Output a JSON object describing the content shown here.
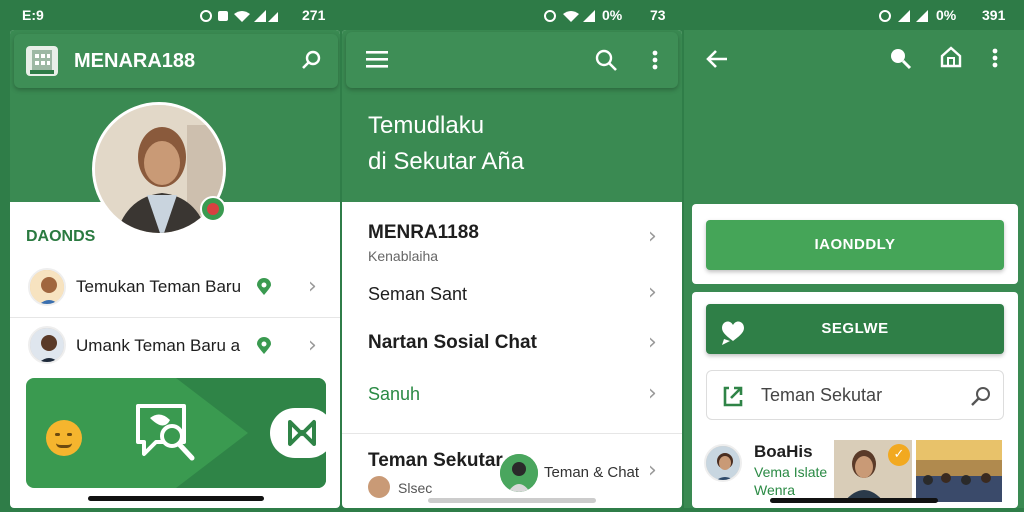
{
  "status": {
    "left_time": "E:9",
    "p1_right": "271",
    "p2_batt": "0%",
    "p2_time": "73",
    "p3_batt": "0%",
    "p3_time": "391"
  },
  "panel1": {
    "app_title": "MENARA188",
    "section_label": "DAONDS",
    "items": [
      {
        "label": "Temukan Teman Baru"
      },
      {
        "label": "Umank Teman Baru a"
      }
    ]
  },
  "panel2": {
    "hero_line1": "Temudlaku",
    "hero_line2": "di Sekutar Aña",
    "items": [
      {
        "title": "MENRA1188",
        "subtitle": "Kenablaiha"
      },
      {
        "title": "Seman Sant"
      },
      {
        "title": "Nartan Sosial Chat"
      },
      {
        "title": "Sanuh"
      }
    ],
    "bottom_title": "Teman Sekutar",
    "bottom_sub": "Slsec",
    "chat_label": "Teman & Chat"
  },
  "panel3": {
    "button1": "IAONDDLY",
    "button2": "SEGLWE",
    "search_value": "Teman Sekutar",
    "card_title": "BoaHis",
    "card_sub1": "Vema Islate",
    "card_sub2": "Wenra"
  },
  "colors": {
    "primary": "#3a8a52",
    "appbar": "#3e8e56",
    "button": "#3f9a55",
    "text": "#1e1e1e",
    "link_green": "#2a8a44"
  }
}
